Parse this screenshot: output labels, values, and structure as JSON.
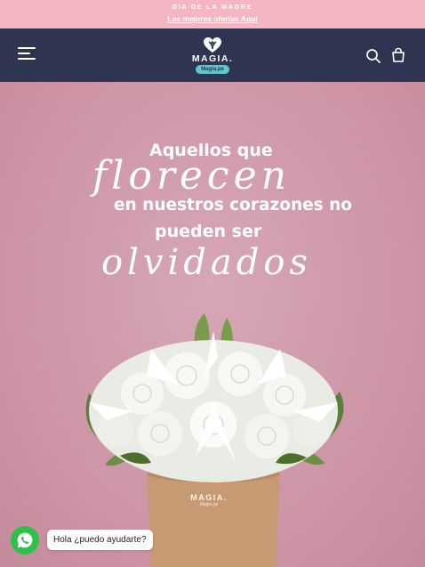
{
  "announcement": {
    "title": "DÍA DE LA MADRE",
    "link_text": "Las mejores ofertas Aquí"
  },
  "header": {
    "logo_text": "MAGIA.",
    "logo_sub": "Magia.pe",
    "menu_icon": "hamburger-menu-icon",
    "search_icon": "search-icon",
    "cart_icon": "shopping-bag-icon",
    "background_color": "#2f3450"
  },
  "hero": {
    "line1": "Aquellos que",
    "line2": "florecen",
    "line3": "en nuestros corazones no",
    "line4": "pueden  ser",
    "line5": "olvidados",
    "box_logo": "MAGIA.",
    "box_logo_sub": "Magia.pe",
    "background_color": "#cc93a4"
  },
  "chat": {
    "icon": "whatsapp-icon",
    "text": "Hola ¿puedo ayudarte?",
    "color": "#2cc24a"
  }
}
